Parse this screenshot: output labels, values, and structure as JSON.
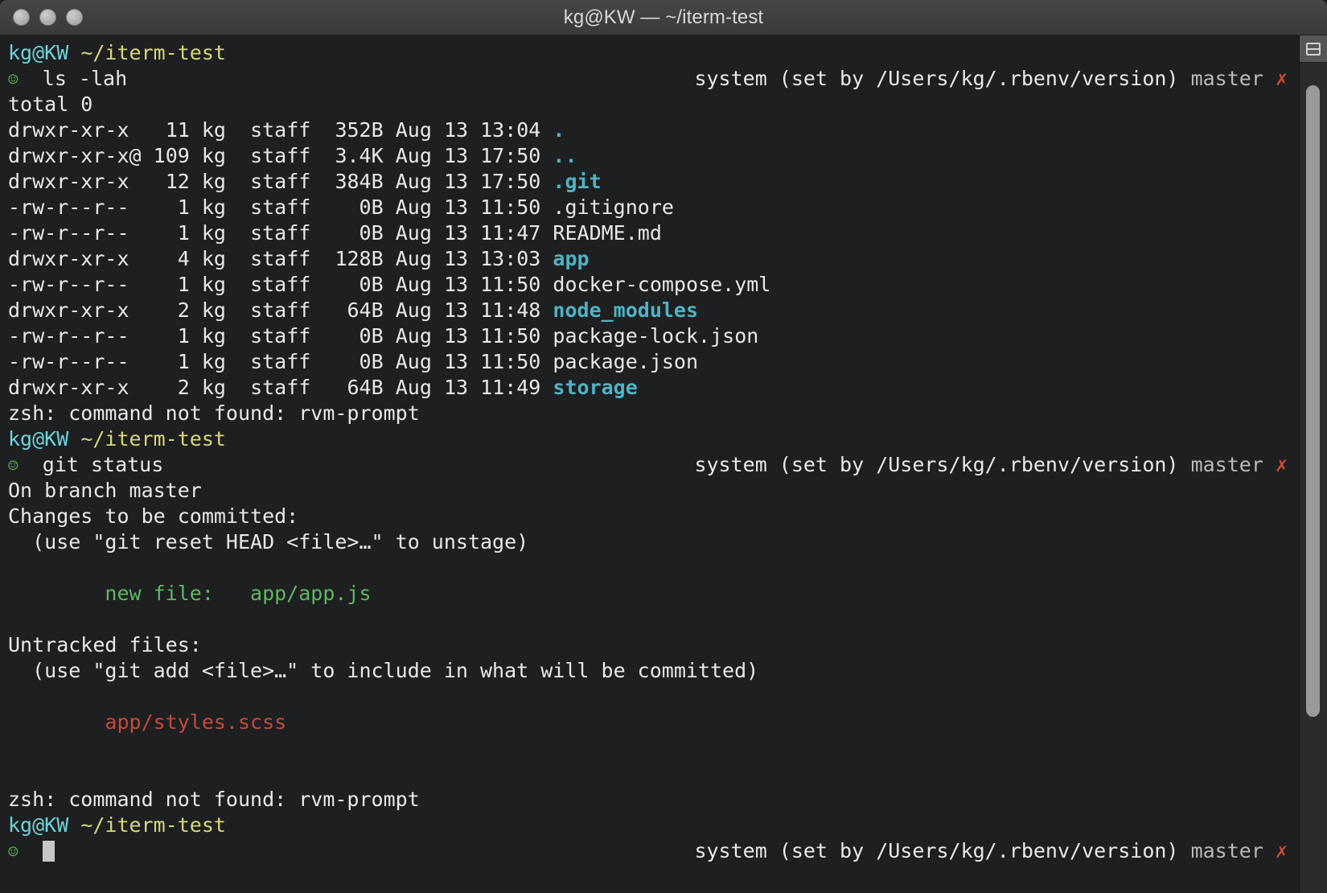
{
  "window": {
    "title": "kg@KW — ~/iterm-test",
    "traffic_lights": [
      "close-button",
      "minimize-button",
      "zoom-button"
    ]
  },
  "scrollbar": {
    "toolbelt_icon": "toolbelt-toggle-icon",
    "thumb_label": "scroll-thumb"
  },
  "prompt": {
    "user_host": "kg@KW",
    "path": "~/iterm-test",
    "status_glyph": "☺",
    "rprompt_ruby": "system (set by /Users/kg/.rbenv/version)",
    "rprompt_branch": "master",
    "rprompt_dirty": "✗"
  },
  "terminal": {
    "commands": {
      "ls": "ls -lah",
      "git_status": "git status"
    },
    "ls_output": {
      "total": "total 0",
      "rows": [
        {
          "perms": "drwxr-xr-x ",
          "links": " 11",
          "owner": "kg",
          "group": "staff",
          "size": "352B",
          "date": "Aug 13 13:04",
          "name": ".",
          "kind": "dir"
        },
        {
          "perms": "drwxr-xr-x@",
          "links": "109",
          "owner": "kg",
          "group": "staff",
          "size": "3.4K",
          "date": "Aug 13 17:50",
          "name": "..",
          "kind": "dir"
        },
        {
          "perms": "drwxr-xr-x ",
          "links": " 12",
          "owner": "kg",
          "group": "staff",
          "size": "384B",
          "date": "Aug 13 17:50",
          "name": ".git",
          "kind": "dir"
        },
        {
          "perms": "-rw-r--r-- ",
          "links": "  1",
          "owner": "kg",
          "group": "staff",
          "size": "  0B",
          "date": "Aug 13 11:50",
          "name": ".gitignore",
          "kind": "file"
        },
        {
          "perms": "-rw-r--r-- ",
          "links": "  1",
          "owner": "kg",
          "group": "staff",
          "size": "  0B",
          "date": "Aug 13 11:47",
          "name": "README.md",
          "kind": "file"
        },
        {
          "perms": "drwxr-xr-x ",
          "links": "  4",
          "owner": "kg",
          "group": "staff",
          "size": "128B",
          "date": "Aug 13 13:03",
          "name": "app",
          "kind": "dir"
        },
        {
          "perms": "-rw-r--r-- ",
          "links": "  1",
          "owner": "kg",
          "group": "staff",
          "size": "  0B",
          "date": "Aug 13 11:50",
          "name": "docker-compose.yml",
          "kind": "file"
        },
        {
          "perms": "drwxr-xr-x ",
          "links": "  2",
          "owner": "kg",
          "group": "staff",
          "size": " 64B",
          "date": "Aug 13 11:48",
          "name": "node_modules",
          "kind": "dir"
        },
        {
          "perms": "-rw-r--r-- ",
          "links": "  1",
          "owner": "kg",
          "group": "staff",
          "size": "  0B",
          "date": "Aug 13 11:50",
          "name": "package-lock.json",
          "kind": "file"
        },
        {
          "perms": "-rw-r--r-- ",
          "links": "  1",
          "owner": "kg",
          "group": "staff",
          "size": "  0B",
          "date": "Aug 13 11:50",
          "name": "package.json",
          "kind": "file"
        },
        {
          "perms": "drwxr-xr-x ",
          "links": "  2",
          "owner": "kg",
          "group": "staff",
          "size": " 64B",
          "date": "Aug 13 11:49",
          "name": "storage",
          "kind": "dir"
        }
      ]
    },
    "errors": {
      "rvm_prompt": "zsh: command not found: rvm-prompt"
    },
    "git_status_output": {
      "branch_line": "On branch master",
      "staged_header": "Changes to be committed:",
      "staged_hint": "  (use \"git reset HEAD <file>…\" to unstage)",
      "staged_file": "        new file:   app/app.js",
      "untracked_header": "Untracked files:",
      "untracked_hint": "  (use \"git add <file>…\" to include in what will be committed)",
      "untracked_file": "        app/styles.scss"
    }
  },
  "colors": {
    "background": "#1d1f21",
    "foreground": "#e8e8e8",
    "user": "#6fd3d8",
    "path": "#d7d77a",
    "directory": "#4fb3c4",
    "green": "#5fb85f",
    "red": "#c9483a",
    "dirty_marker": "#cf4b34",
    "titlebar": "#3f3f3f"
  }
}
